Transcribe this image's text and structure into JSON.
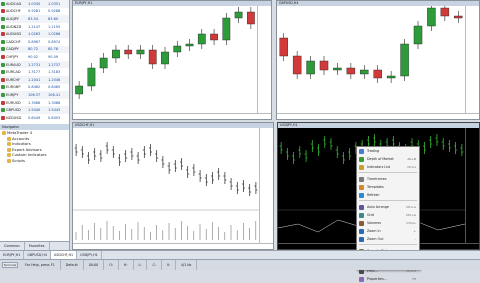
{
  "market_watch": {
    "rows": [
      {
        "symbol": "AUDCAD",
        "bid": "1.0345",
        "ask": "1.0351",
        "dir": "up"
      },
      {
        "symbol": "AUDCHF",
        "bid": "0.9281",
        "ask": "0.9288",
        "dir": "down"
      },
      {
        "symbol": "AUDJPY",
        "bid": "83.54",
        "ask": "83.60",
        "dir": "up"
      },
      {
        "symbol": "AUDNZD",
        "bid": "1.2147",
        "ask": "1.2155",
        "dir": "up"
      },
      {
        "symbol": "AUDUSD",
        "bid": "1.0263",
        "ask": "1.0266",
        "dir": "down"
      },
      {
        "symbol": "CADCHF",
        "bid": "0.8967",
        "ask": "0.8974",
        "dir": "up"
      },
      {
        "symbol": "CADJPY",
        "bid": "80.72",
        "ask": "80.78",
        "dir": "up"
      },
      {
        "symbol": "CHFJPY",
        "bid": "90.02",
        "ask": "90.09",
        "dir": "down"
      },
      {
        "symbol": "EURAUD",
        "bid": "1.2731",
        "ask": "1.2737",
        "dir": "up"
      },
      {
        "symbol": "EURCAD",
        "bid": "1.3177",
        "ask": "1.3183",
        "dir": "up"
      },
      {
        "symbol": "EURCHF",
        "bid": "1.2041",
        "ask": "1.2046",
        "dir": "down"
      },
      {
        "symbol": "EURGBP",
        "bid": "0.8462",
        "ask": "0.8465",
        "dir": "up"
      },
      {
        "symbol": "EURJPY",
        "bid": "106.37",
        "ask": "106.41",
        "dir": "up"
      },
      {
        "symbol": "EURUSD",
        "bid": "1.3066",
        "ask": "1.3068",
        "dir": "down"
      },
      {
        "symbol": "GBPUSD",
        "bid": "1.5440",
        "ask": "1.5443",
        "dir": "up"
      },
      {
        "symbol": "NZDUSD",
        "bid": "0.8449",
        "ask": "0.8453",
        "dir": "down"
      }
    ]
  },
  "navigator": {
    "title": "Navigator",
    "nodes": [
      "MetaTrader 4",
      "Accounts",
      "Indicators",
      "Expert Advisors",
      "Custom Indicators",
      "Scripts"
    ]
  },
  "nav_tabs": [
    "Common",
    "Favorites"
  ],
  "charts": [
    {
      "caption": "EURJPY,H1"
    },
    {
      "caption": "GBPUSD,H4"
    },
    {
      "caption": "USDCHF,H1"
    },
    {
      "caption": "USDJPY,H1"
    }
  ],
  "context_menu": {
    "items": [
      {
        "label": "Trading",
        "shortcut": "",
        "icon": "trading-icon"
      },
      {
        "label": "Depth of Market",
        "shortcut": "Alt+B",
        "icon": "dom-icon"
      },
      {
        "label": "Indicators List",
        "shortcut": "Ctrl+I",
        "icon": "indicators-icon"
      },
      {
        "label": "Timeframes",
        "shortcut": "",
        "icon": "timeframe-icon"
      },
      {
        "label": "Templates",
        "shortcut": "",
        "icon": "template-icon"
      },
      {
        "label": "Refresh",
        "shortcut": "",
        "icon": "refresh-icon"
      },
      {
        "label": "Auto Arrange",
        "shortcut": "Ctrl+A",
        "icon": "arrange-icon"
      },
      {
        "label": "Grid",
        "shortcut": "Ctrl+G",
        "icon": "grid-icon"
      },
      {
        "label": "Volumes",
        "shortcut": "Ctrl+L",
        "icon": "volumes-icon"
      },
      {
        "label": "Zoom In",
        "shortcut": "+",
        "icon": "zoom-in-icon"
      },
      {
        "label": "Zoom Out",
        "shortcut": "-",
        "icon": "zoom-out-icon"
      },
      {
        "label": "Save As Picture",
        "shortcut": "",
        "icon": "picture-icon"
      },
      {
        "label": "Print Preview",
        "shortcut": "",
        "icon": "print-preview-icon"
      },
      {
        "label": "Print...",
        "shortcut": "Ctrl+P",
        "icon": "print-icon"
      },
      {
        "label": "Properties...",
        "shortcut": "F8",
        "icon": "properties-icon"
      }
    ]
  },
  "chart_tabs": [
    "EURJPY,H1",
    "GBPUSD,H4",
    "USDCHF,H1",
    "USDJPY,H1"
  ],
  "statusbar": [
    "For Help, press F1",
    "Default",
    "00:00",
    "O:",
    "H:",
    "L:",
    "C:",
    "V:",
    "4/1 kb"
  ],
  "terminal_label": "Terminal",
  "colors": {
    "bull": "#2e9b3a",
    "bear": "#d23a3a",
    "dark_bull": "#3cd23c"
  }
}
